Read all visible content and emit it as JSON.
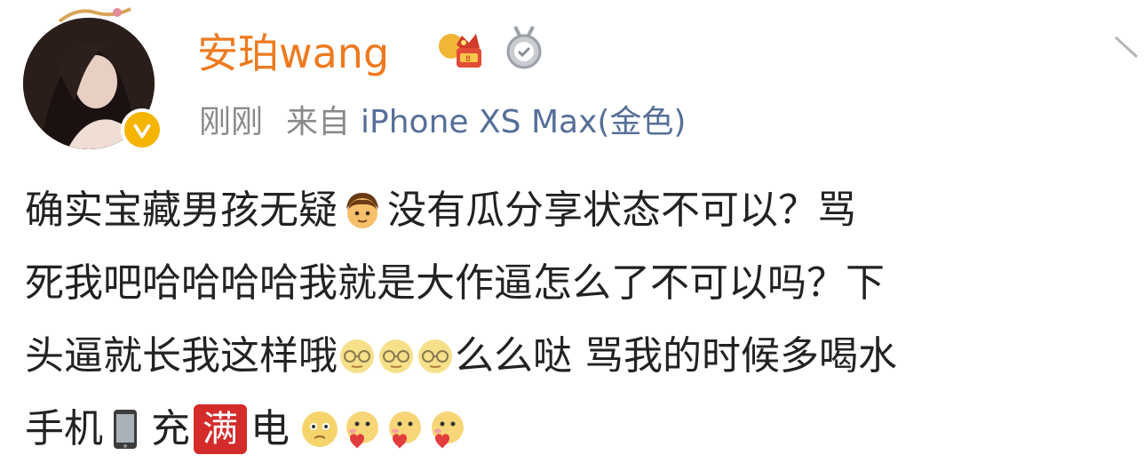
{
  "post": {
    "username": "安珀wang",
    "time": "刚刚",
    "source_prefix": "来自",
    "device": "iPhone XS Max(金色)",
    "lines": [
      {
        "a": "确实宝藏男孩无疑",
        "b": "没有瓜分享状态不可以？骂"
      },
      {
        "a": "死我吧哈哈哈哈我就是大作逼怎么了不可以吗？下"
      },
      {
        "a": "头逼就长我这样哦",
        "b": "么么哒 骂我的时候多喝水"
      },
      {
        "a": "手机",
        "b": "充",
        "badge": "满",
        "c": "电"
      }
    ]
  },
  "icons": {
    "avatar": "avatar",
    "verified": "verified-badge-icon",
    "crown": "crown-vip-icon",
    "medal": "medal-icon",
    "collapse": "chevron-down-icon",
    "emoji_boy": "boy-emoji-icon",
    "emoji_glasses": "nerd-glasses-emoji-icon",
    "emoji_phone": "mobile-phone-icon",
    "emoji_pitiful": "pitiful-face-emoji-icon",
    "emoji_heart": "heart-face-emoji-icon"
  },
  "colors": {
    "username": "#ee7a1f",
    "device": "#566f99",
    "meta": "#8a8a8a",
    "verified": "#f4b400",
    "badge_red": "#d42b2b"
  }
}
